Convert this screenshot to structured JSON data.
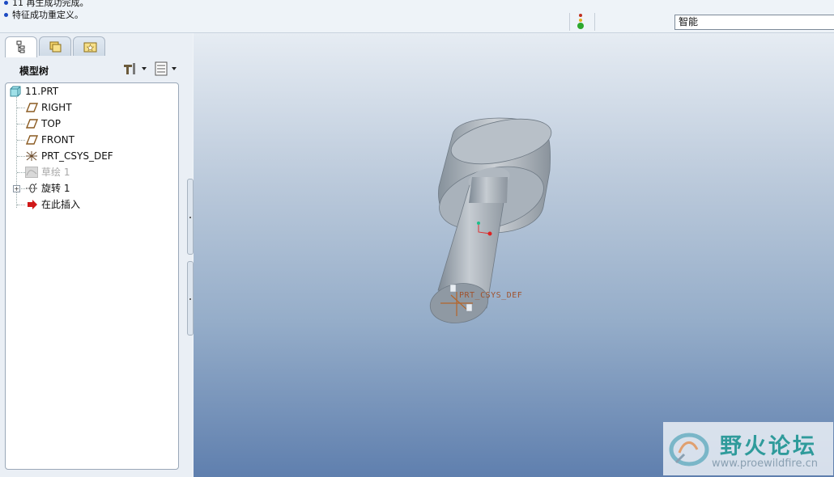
{
  "messages": [
    "11 再生成功完成。",
    "特征成功重定义。"
  ],
  "filter": {
    "value": "智能"
  },
  "panel": {
    "tabs": [
      "model-tree",
      "folder-browser",
      "favorites"
    ],
    "title": "模型树"
  },
  "tree": {
    "root": "11.PRT",
    "items": [
      {
        "label": "RIGHT",
        "icon": "datum-plane-icon"
      },
      {
        "label": "TOP",
        "icon": "datum-plane-icon"
      },
      {
        "label": "FRONT",
        "icon": "datum-plane-icon"
      },
      {
        "label": "PRT_CSYS_DEF",
        "icon": "csys-icon"
      },
      {
        "label": "草绘 1",
        "icon": "sketch-icon",
        "suppressed": true
      },
      {
        "label": "旋转 1",
        "icon": "revolve-icon",
        "expandable": true
      },
      {
        "label": "在此插入",
        "icon": "insert-arrow-icon"
      }
    ]
  },
  "viewport": {
    "csys_label": "PRT_CSYS_DEF"
  },
  "watermark": {
    "title": "野火论坛",
    "url": "www.proewildfire.cn"
  },
  "colors": {
    "accent": "#1b49c2",
    "csys": "#a0522d",
    "watermark": "#2f9b9b"
  }
}
